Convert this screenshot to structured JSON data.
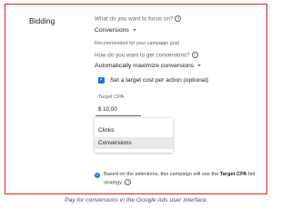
{
  "section": {
    "label": "Bidding"
  },
  "focus": {
    "question": "What do you want to focus on?",
    "selected": "Conversions",
    "hint": "Recommended for your campaign goal"
  },
  "method": {
    "question": "How do you want to get conversions?",
    "selected": "Automatically maximize conversions"
  },
  "target_cpa_option": {
    "checkbox_label": "Set a target cost per action (optional)",
    "checked": true
  },
  "target_cpa": {
    "label": "Target CPA",
    "value": "$ 10.00"
  },
  "focus_menu": {
    "options": [
      "Clicks",
      "Conversions"
    ],
    "highlighted": "Conversions"
  },
  "info": {
    "text_before": "Based on the selections, this campaign will use the ",
    "strategy": "Target CPA",
    "text_after": " bid strategy"
  },
  "caption": "Pay for conversions in the Google Ads user interface.",
  "colors": {
    "frame_border": "#e0201a",
    "accent": "#1a73e8",
    "highlight": "#e9e9e9"
  },
  "icons": [
    "help-icon",
    "chevron-down-icon",
    "check-icon",
    "info-icon"
  ]
}
